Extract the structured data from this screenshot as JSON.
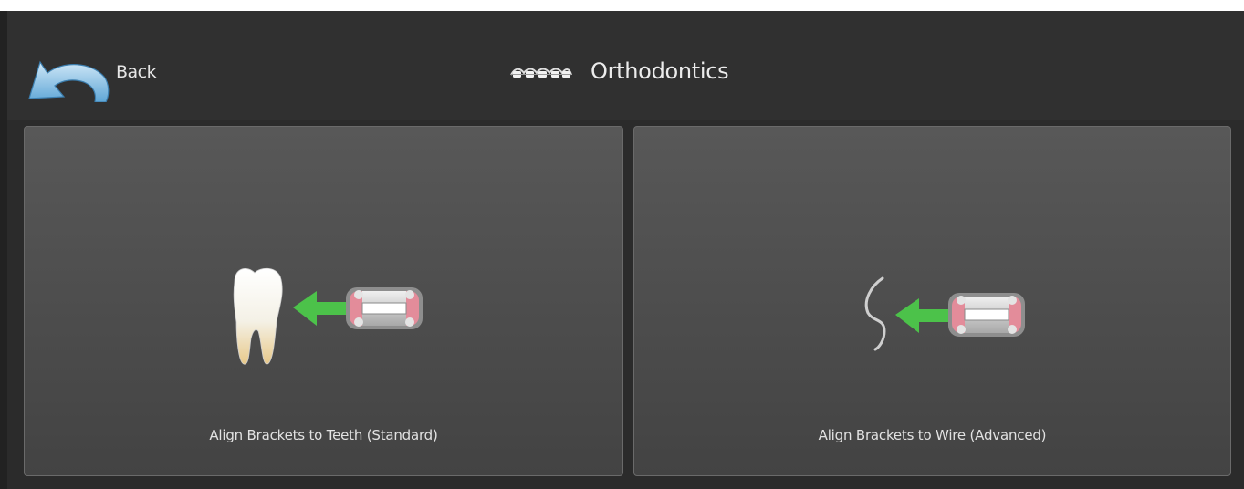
{
  "header": {
    "back_label": "Back",
    "title": "Orthodontics"
  },
  "options": [
    {
      "label": "Align Brackets to Teeth (Standard)",
      "icon": "tooth-bracket-icon"
    },
    {
      "label": "Align Brackets to Wire (Advanced)",
      "icon": "wire-bracket-icon"
    }
  ],
  "colors": {
    "background": "#2b2b2b",
    "panel": "#505050",
    "arrow_green": "#4cc24a",
    "back_arrow_blue": "#8ec5e8",
    "bracket_pink": "#e38c9a"
  }
}
